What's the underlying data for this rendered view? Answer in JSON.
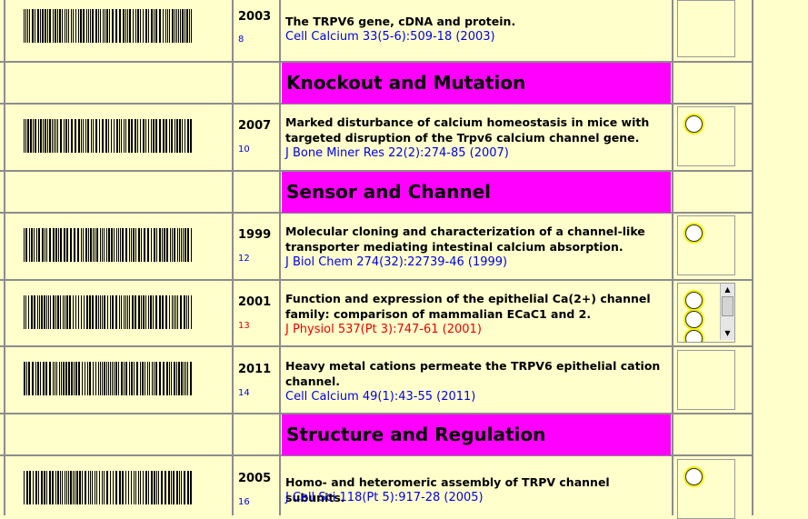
{
  "rows": [
    {
      "year": "2003",
      "num": "8",
      "title": "The TRPV6 gene, cDNA and protein.",
      "cite": "Cell Calcium 33(5-6):509-18 (2003)",
      "radios": 0
    },
    {
      "section": "Knockout and Mutation"
    },
    {
      "year": "2007",
      "num": "10",
      "title": "Marked disturbance of calcium homeostasis in mice with targeted disruption of the Trpv6 calcium channel gene.",
      "cite": "J Bone Miner Res 22(2):274-85 (2007)",
      "radios": 1
    },
    {
      "section": "Sensor and Channel"
    },
    {
      "year": "1999",
      "num": "12",
      "title": "Molecular cloning and characterization of a channel-like transporter mediating intestinal calcium absorption.",
      "cite": "J Biol Chem 274(32):22739-46 (1999)",
      "radios": 1
    },
    {
      "year": "2001",
      "num": "13",
      "title": "Function and expression of the epithelial Ca(2+) channel family: comparison of mammalian ECaC1 and 2.",
      "cite": "J Physiol 537(Pt 3):747-61 (2001)",
      "radios": 3,
      "highlight": true
    },
    {
      "year": "2011",
      "num": "14",
      "title": "Heavy metal cations permeate the TRPV6 epithelial cation channel.",
      "cite": "Cell Calcium 49(1):43-55 (2011)",
      "radios": 0
    },
    {
      "section": "Structure and Regulation"
    },
    {
      "year": "2005",
      "num": "16",
      "title": "Homo- and heteromeric assembly of TRPV channel subunits.",
      "cite": "J Cell Sci 118(Pt 5):917-28 (2005)",
      "radios": 1
    }
  ],
  "colors": {
    "section_bg": "#ff00ff",
    "page_bg": "#ffffcc",
    "link": "#0000ee",
    "visited_link": "#ee0000",
    "radio_highlight": "#f0f000"
  }
}
